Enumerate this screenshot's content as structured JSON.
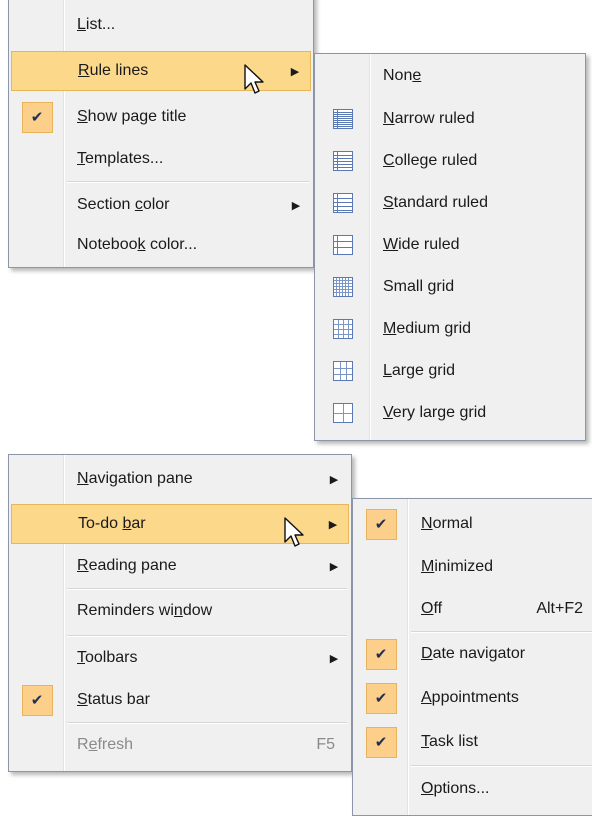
{
  "view_menu": {
    "items": [
      {
        "pre": "",
        "key": "L",
        "post": "ist..."
      },
      {
        "pre": "",
        "key": "R",
        "post": "ule lines"
      },
      {
        "pre": "",
        "key": "S",
        "post": "how page title"
      },
      {
        "pre": "",
        "key": "T",
        "post": "emplates..."
      },
      {
        "pre": "Section ",
        "key": "c",
        "post": "olor"
      },
      {
        "pre": "Noteboo",
        "key": "k",
        "post": " color..."
      }
    ],
    "check_icon": "✔",
    "arrow_icon": "▶"
  },
  "rule_lines_menu": {
    "items": [
      {
        "pre": "Non",
        "key": "e",
        "post": "",
        "icon": "none"
      },
      {
        "pre": "",
        "key": "N",
        "post": "arrow ruled",
        "icon": "narrow-ruled-icon"
      },
      {
        "pre": "",
        "key": "C",
        "post": "ollege ruled",
        "icon": "college-ruled-icon"
      },
      {
        "pre": "",
        "key": "S",
        "post": "tandard ruled",
        "icon": "standard-ruled-icon"
      },
      {
        "pre": "",
        "key": "W",
        "post": "ide ruled",
        "icon": "wide-ruled-icon"
      },
      {
        "pre": "Small ",
        "key": "g",
        "post": "rid",
        "icon": "small-grid-icon"
      },
      {
        "pre": "",
        "key": "M",
        "post": "edium grid",
        "icon": "medium-grid-icon"
      },
      {
        "pre": "",
        "key": "L",
        "post": "arge grid",
        "icon": "large-grid-icon"
      },
      {
        "pre": "",
        "key": "V",
        "post": "ery large grid",
        "icon": "very-large-grid-icon"
      }
    ]
  },
  "outlook_view_menu": {
    "items": [
      {
        "pre": "",
        "key": "N",
        "post": "avigation pane"
      },
      {
        "pre": "To-do ",
        "key": "b",
        "post": "ar"
      },
      {
        "pre": "",
        "key": "R",
        "post": "eading pane"
      },
      {
        "pre": "Reminders wi",
        "key": "n",
        "post": "dow"
      },
      {
        "pre": "",
        "key": "T",
        "post": "oolbars"
      },
      {
        "pre": "",
        "key": "S",
        "post": "tatus bar"
      },
      {
        "pre": "R",
        "key": "e",
        "post": "fresh",
        "shortcut": "F5"
      }
    ]
  },
  "todo_bar_menu": {
    "items": [
      {
        "pre": "",
        "key": "N",
        "post": "ormal"
      },
      {
        "pre": "",
        "key": "M",
        "post": "inimized"
      },
      {
        "pre": "",
        "key": "O",
        "post": "ff",
        "shortcut": "Alt+F2"
      },
      {
        "pre": "",
        "key": "D",
        "post": "ate navigator"
      },
      {
        "pre": "",
        "key": "A",
        "post": "ppointments"
      },
      {
        "pre": "",
        "key": "T",
        "post": "ask list"
      },
      {
        "pre": "",
        "key": "O",
        "post": "ptions..."
      }
    ]
  },
  "colors": {
    "highlight": "#fcd88b",
    "highlight_border": "#e6b659",
    "menu_bg": "#f0f0f0",
    "icon_blue": "#6f8cc4",
    "icon_red": "#d9534f"
  }
}
